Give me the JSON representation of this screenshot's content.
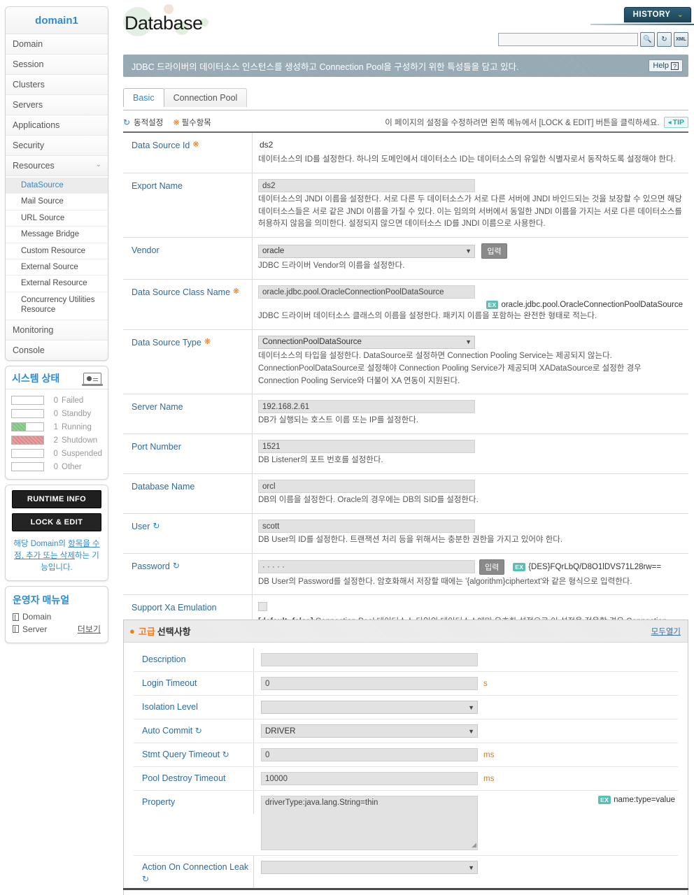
{
  "sidebar": {
    "domain_title": "domain1",
    "nav": [
      {
        "label": "Domain"
      },
      {
        "label": "Session"
      },
      {
        "label": "Clusters"
      },
      {
        "label": "Servers"
      },
      {
        "label": "Applications"
      },
      {
        "label": "Security"
      },
      {
        "label": "Resources",
        "chevron": "⌄"
      }
    ],
    "subnav": [
      {
        "label": "DataSource",
        "active": true
      },
      {
        "label": "Mail Source"
      },
      {
        "label": "URL Source"
      },
      {
        "label": "Message Bridge"
      },
      {
        "label": "Custom Resource"
      },
      {
        "label": "External Source"
      },
      {
        "label": "External Resource"
      },
      {
        "label": "Concurrency Utilities Resource"
      }
    ],
    "nav_bottom": [
      {
        "label": "Monitoring"
      },
      {
        "label": "Console"
      }
    ],
    "system_status": {
      "title": "시스템 상태",
      "icon": "monitor-icon",
      "rows": [
        {
          "count": "0",
          "label": "Failed",
          "fill": 0,
          "color": ""
        },
        {
          "count": "0",
          "label": "Standby",
          "fill": 0,
          "color": ""
        },
        {
          "count": "1",
          "label": "Running",
          "fill": 45,
          "color": "#7cc47c"
        },
        {
          "count": "2",
          "label": "Shutdown",
          "fill": 100,
          "color": "#d98a8a"
        },
        {
          "count": "0",
          "label": "Suspended",
          "fill": 0,
          "color": ""
        },
        {
          "count": "0",
          "label": "Other",
          "fill": 0,
          "color": ""
        }
      ]
    },
    "runtime_info_button": "RUNTIME INFO",
    "lock_edit_button": "LOCK & EDIT",
    "lock_note_a": "해당 Domain의 ",
    "lock_note_link": "항목을 수정, 추가 또는 삭제",
    "lock_note_b": "하는 기능입니다.",
    "manual": {
      "title": "운영자 매뉴얼",
      "items": [
        "Domain",
        "Server"
      ],
      "more": "더보기"
    }
  },
  "header": {
    "page_title": "Database",
    "history_button": "HISTORY",
    "history_chevron": "⌄",
    "search_value": "",
    "search_placeholder": "",
    "icons": [
      "search-icon",
      "refresh-icon",
      "xml-export-icon"
    ],
    "description": "JDBC 드라이버의 데이터소스 인스턴스를 생성하고 Connection Pool을 구성하기 위한 특성들을 담고 있다.",
    "help_label": "Help"
  },
  "tabs": [
    {
      "label": "Basic",
      "active": true
    },
    {
      "label": "Connection Pool",
      "active": false
    }
  ],
  "legend": {
    "dynamic": "동적설정",
    "required": "필수항목",
    "note": "이 페이지의 설정을 수정하려면 왼쪽 메뉴에서 [LOCK & EDIT] 버튼을 클릭하세요.",
    "tip": "TIP"
  },
  "form": {
    "rows": [
      {
        "label": "Data Source Id",
        "required": true,
        "dynamic": false,
        "control": "text",
        "value": "ds2",
        "desc": "데이터소스의 ID를 설정한다. 하나의 도메인에서 데이터소스 ID는 데이터소스의 유일한 식별자로서 동작하도록 설정해야 한다."
      },
      {
        "label": "Export Name",
        "required": false,
        "dynamic": false,
        "control": "input",
        "value": "ds2",
        "desc": "데이터소스의 JNDI 이름을 설정한다. 서로 다른 두 데이터소스가 서로 다른 서버에 JNDI 바인드되는 것을 보장할 수 있으면 해당 데이터소스들은 서로 같은 JNDI 이름을 가질 수 있다. 이는 임의의 서버에서 동일한 JNDI 이름을 가지는 서로 다른 데이터소스를 허용하지 않음을 의미한다. 설정되지 않으면 데이터소스 ID를 JNDI 이름으로 사용한다."
      },
      {
        "label": "Vendor",
        "required": false,
        "dynamic": false,
        "control": "select-button",
        "value": "oracle",
        "button": "입력",
        "desc": "JDBC 드라이버 Vendor의 이름을 설정한다."
      },
      {
        "label": "Data Source Class Name",
        "required": true,
        "dynamic": false,
        "control": "input",
        "value": "oracle.jdbc.pool.OracleConnectionPoolDataSource",
        "example_badge": "EX",
        "example": "oracle.jdbc.pool.OracleConnectionPoolDataSource",
        "desc": "JDBC 드라이버 데이터소스 클래스의 이름을 설정한다. 패키지 이름을 포함하는 완전한 형태로 적는다."
      },
      {
        "label": "Data Source Type",
        "required": true,
        "dynamic": false,
        "control": "select",
        "value": "ConnectionPoolDataSource",
        "desc": "데이터소스의 타입을 설정한다. DataSource로 설정하면 Connection Pooling Service는 제공되지 않는다. ConnectionPoolDataSource로 설정해야 Connection Pooling Service가 제공되며 XADataSource로 설정한 경우 Connection Pooling Service와 더불어 XA 연동이 지원된다."
      },
      {
        "label": "Server Name",
        "required": false,
        "dynamic": false,
        "control": "input",
        "value": "192.168.2.61",
        "desc": "DB가 실행되는 호스트 이름 또는 IP를 설정한다."
      },
      {
        "label": "Port Number",
        "required": false,
        "dynamic": false,
        "control": "input",
        "value": "1521",
        "desc": "DB Listener의 포트 번호를 설정한다."
      },
      {
        "label": "Database Name",
        "required": false,
        "dynamic": false,
        "control": "input",
        "value": "orcl",
        "desc": "DB의 이름을 설정한다. Oracle의 경우에는 DB의 SID를 설정한다."
      },
      {
        "label": "User",
        "required": false,
        "dynamic": true,
        "control": "input",
        "value": "scott",
        "desc": "DB User의 ID를 설정한다. 트랜잭션 처리 등을 위해서는 충분한 권한을 가지고 있어야 한다."
      },
      {
        "label": "Password",
        "required": false,
        "dynamic": true,
        "control": "password-button",
        "value": "· · · · ·",
        "button": "입력",
        "example_badge": "EX",
        "example": "{DES}FQrLbQ/D8O1lDVS71L28rw==",
        "desc": "DB User의 Password를 설정한다. 암호화해서 저장할 때에는 '{algorithm}ciphertext'와 같은 형식으로 입력한다."
      },
      {
        "label": "Support Xa Emulation",
        "required": false,
        "dynamic": false,
        "control": "checkbox",
        "checked": false,
        "desc_prefix": "[default: false]",
        "desc": "Connection Pool 데이터소스 타입의 데이터소스에만 유효한 설정으로 이 설정을 적용할 경우 Connection Pool 데이터소스의 커넥션이 글로벌 트랜잭션(XA)에 참여하도록 에뮬레이션한다. JEUS 6 까지의 LocalXADataSource의 대체 옵션으로 ConnectionPoolDataSource 타입의 Connection Pool에 사용한다. 하나의 트랜잭션에는 하나의 Connection Pool 데이터소스만 참여할 수 있다는 점에 유의해야 한다."
      }
    ]
  },
  "advanced": {
    "title_orange": "고급",
    "title_rest": "선택사항",
    "expand_all": "모두열기",
    "rows": [
      {
        "label": "Description",
        "dynamic": false,
        "control": "input",
        "value": "",
        "unit": ""
      },
      {
        "label": "Login Timeout",
        "dynamic": false,
        "control": "input",
        "value": "0",
        "unit": "s"
      },
      {
        "label": "Isolation Level",
        "dynamic": false,
        "control": "select",
        "value": "",
        "unit": ""
      },
      {
        "label": "Auto Commit",
        "dynamic": true,
        "control": "select",
        "value": "DRIVER",
        "unit": ""
      },
      {
        "label": "Stmt Query Timeout",
        "dynamic": true,
        "control": "input",
        "value": "0",
        "unit": "ms"
      },
      {
        "label": "Pool Destroy Timeout",
        "dynamic": false,
        "control": "input",
        "value": "10000",
        "unit": "ms"
      },
      {
        "label": "Property",
        "dynamic": false,
        "control": "textarea",
        "value": "driverType:java.lang.String=thin",
        "unit": "",
        "example_badge": "EX",
        "example": "name:type=value"
      },
      {
        "label": "Action On Connection Leak",
        "dynamic": true,
        "control": "select",
        "value": "",
        "unit": ""
      }
    ]
  }
}
